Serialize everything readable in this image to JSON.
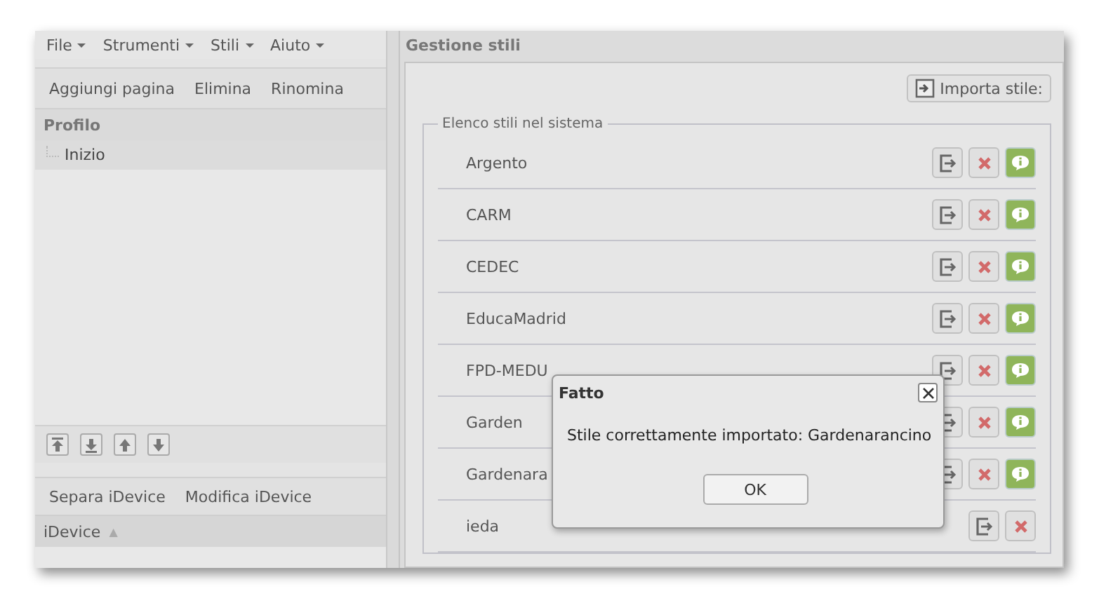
{
  "menu": [
    {
      "label": "File"
    },
    {
      "label": "Strumenti"
    },
    {
      "label": "Stili"
    },
    {
      "label": "Aiuto"
    }
  ],
  "page_toolbar": [
    "Aggiungi pagina",
    "Elimina",
    "Rinomina"
  ],
  "outline": {
    "title": "Profilo",
    "items": [
      {
        "label": "Inizio",
        "selected": true
      }
    ]
  },
  "idevice_toolbar": [
    "Separa iDevice",
    "Modifica iDevice"
  ],
  "idevice_header": {
    "label": "iDevice",
    "sort_indicator": "▲"
  },
  "styles_panel": {
    "title": "Gestione stili",
    "import_button": "Importa stile:",
    "legend": "Elenco stili nel sistema",
    "styles": [
      {
        "name": "Argento",
        "has_info": true
      },
      {
        "name": "CARM",
        "has_info": true
      },
      {
        "name": "CEDEC",
        "has_info": true
      },
      {
        "name": "EducaMadrid",
        "has_info": true
      },
      {
        "name": "FPD-MEDU",
        "has_info": true
      },
      {
        "name": "Garden",
        "has_info": true
      },
      {
        "name": "Gardenara",
        "has_info": true
      },
      {
        "name": "ieda",
        "has_info": false
      }
    ]
  },
  "dialog": {
    "title": "Fatto",
    "message": "Stile correttamente importato: Gardenarancino",
    "button": "OK"
  }
}
